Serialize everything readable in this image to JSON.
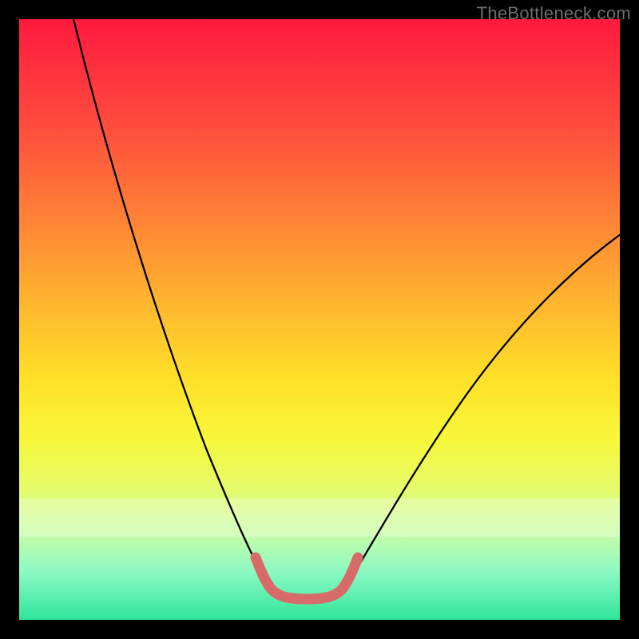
{
  "watermark": "TheBottleneck.com",
  "colors": {
    "frame_bg_top": "#ff1a3e",
    "frame_bg_bottom": "#2fe59b",
    "page_bg": "#000000",
    "curve_stroke": "#000000",
    "tie_stroke": "#d96a6a",
    "whiteband": "rgba(255,255,255,0.28)"
  },
  "chart_data": {
    "type": "line",
    "title": "",
    "xlabel": "",
    "ylabel": "",
    "xlim": [
      0,
      100
    ],
    "ylim": [
      0,
      100
    ],
    "series": [
      {
        "name": "left-branch",
        "x": [
          9,
          12,
          15,
          18,
          21,
          24,
          27,
          30,
          33,
          36,
          38,
          40,
          42
        ],
        "values": [
          100,
          90,
          80,
          70,
          60,
          50,
          40,
          30,
          20,
          10,
          5,
          2,
          0
        ]
      },
      {
        "name": "right-branch",
        "x": [
          54,
          56,
          58,
          61,
          64,
          68,
          73,
          79,
          86,
          94,
          100
        ],
        "values": [
          0,
          2,
          5,
          10,
          16,
          23,
          31,
          40,
          49,
          58,
          64
        ]
      },
      {
        "name": "valley-floor",
        "x": [
          42,
          44,
          47,
          50,
          53,
          54
        ],
        "values": [
          0,
          0,
          0,
          0,
          0,
          0
        ]
      }
    ],
    "annotations": [
      {
        "text": "TheBottleneck.com",
        "position": "top-right"
      }
    ],
    "whiteband_y_range": [
      15,
      20
    ]
  }
}
